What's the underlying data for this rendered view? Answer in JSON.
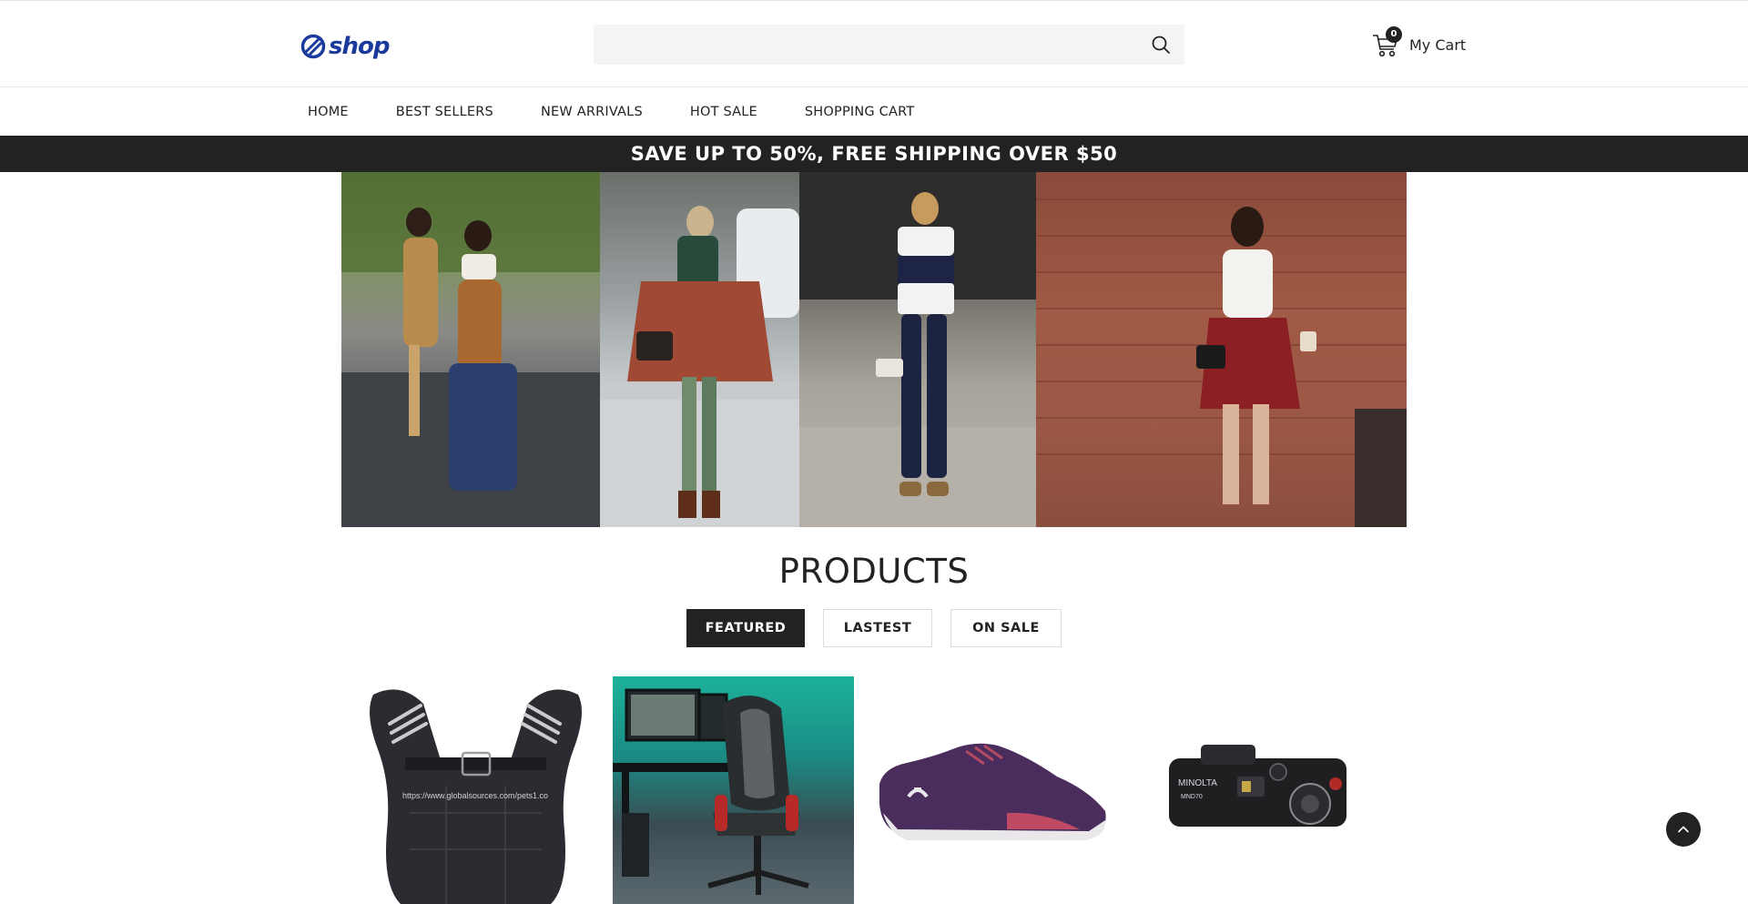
{
  "header": {
    "logo": "shop",
    "search": {
      "placeholder": "",
      "value": ""
    },
    "cart": {
      "count": "0",
      "label": "My Cart"
    }
  },
  "nav": {
    "items": [
      "HOME",
      "BEST SELLERS",
      "NEW ARRIVALS",
      "HOT SALE",
      "SHOPPING CART"
    ]
  },
  "promo": "SAVE UP TO 50%, FREE SHIPPING OVER $50",
  "products": {
    "title": "PRODUCTS",
    "tabs": [
      "FEATURED",
      "LASTEST",
      "ON SALE"
    ],
    "active_tab": "FEATURED",
    "items": [
      {
        "icon": "weighted-vest-image",
        "watermark": "https://www.globalsources.com/pets1.co"
      },
      {
        "icon": "gaming-chair-image"
      },
      {
        "icon": "sneaker-image"
      },
      {
        "icon": "camera-image",
        "brand_text": "MINOLTA",
        "model_text": "MND70"
      }
    ]
  },
  "colors": {
    "accent_dark": "#222222",
    "brand_blue": "#1a3a9c",
    "search_bg": "#f4f4f4"
  }
}
